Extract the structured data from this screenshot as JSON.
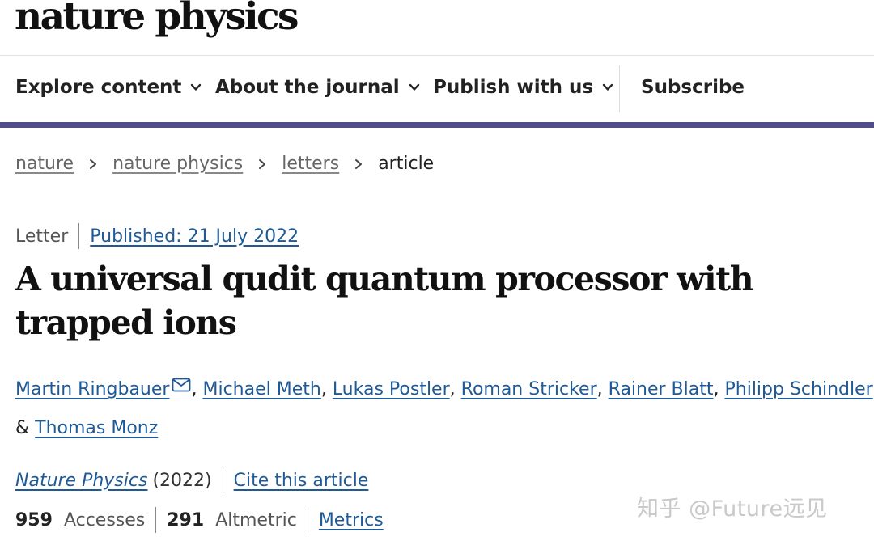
{
  "logo": {
    "text": "nature physics"
  },
  "nav": {
    "items": [
      {
        "label": "Explore content"
      },
      {
        "label": "About the journal"
      },
      {
        "label": "Publish with us"
      }
    ],
    "subscribe": "Subscribe"
  },
  "breadcrumb": {
    "items": [
      "nature",
      "nature physics",
      "letters"
    ],
    "current": "article"
  },
  "meta": {
    "type": "Letter",
    "published": "Published: 21 July 2022"
  },
  "article": {
    "title": "A universal qudit quantum processor with trapped ions"
  },
  "authors": {
    "list": [
      "Martin Ringbauer",
      "Michael Meth",
      "Lukas Postler",
      "Roman Stricker",
      "Rainer Blatt",
      "Philipp Schindler",
      "Thomas Monz"
    ],
    "separator": ", ",
    "conjunction": " & ",
    "corresponding_icon": "mail-icon"
  },
  "journal": {
    "name": "Nature Physics",
    "year": "(2022)",
    "cite": "Cite this article"
  },
  "metrics": {
    "accesses_value": "959",
    "accesses_label": "Accesses",
    "altmetric_value": "291",
    "altmetric_label": "Altmetric",
    "metrics_link": "Metrics"
  },
  "watermark": {
    "text": "知乎 @Future远见"
  },
  "colors": {
    "accent_bar": "#4f4c8c",
    "link": "#1f5a96",
    "text": "#222222"
  }
}
